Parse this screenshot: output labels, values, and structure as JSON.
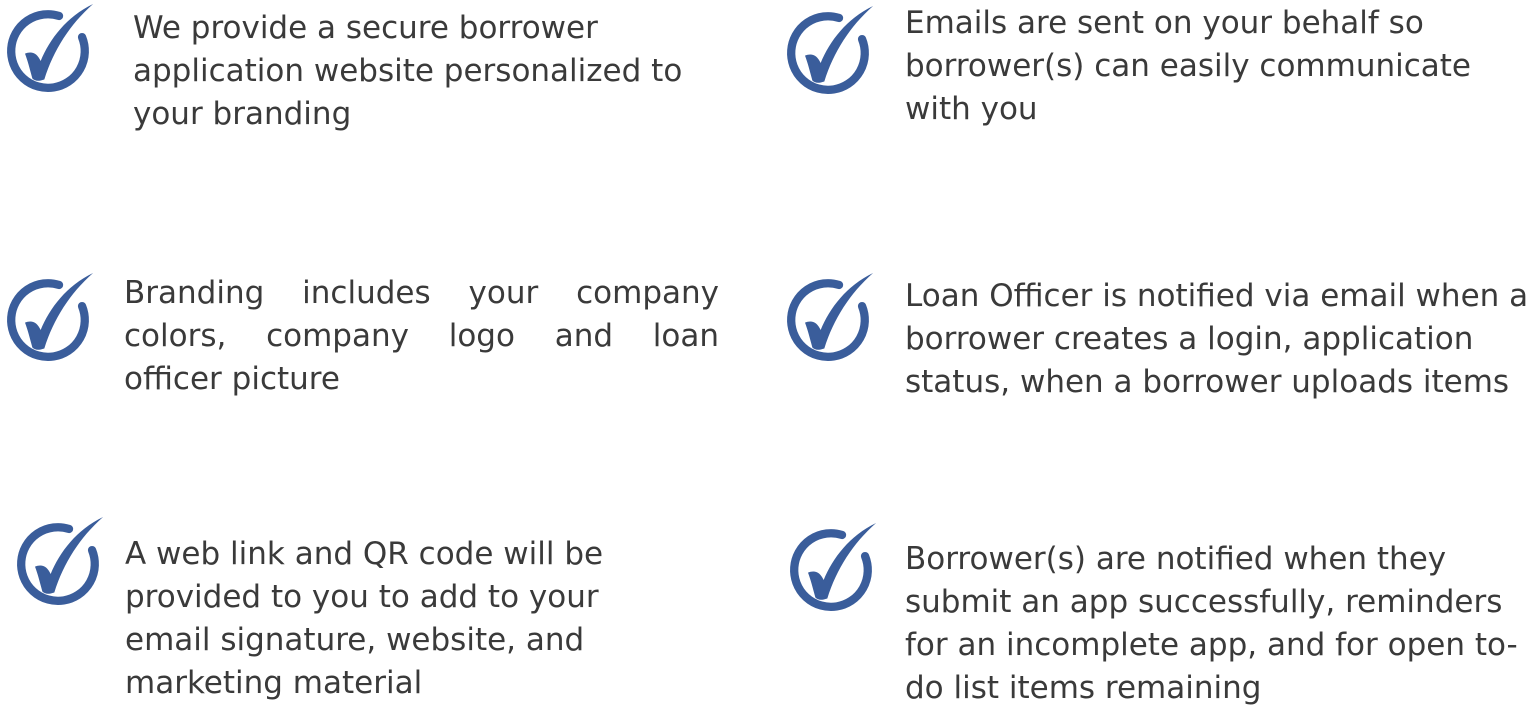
{
  "brand": {
    "check_color": "#3a5d9b",
    "text_color": "#3a3a3a"
  },
  "features": [
    {
      "icon": "checkmark-circle-icon",
      "lines": [
        "We provide a secure borrower",
        "application website personalized to",
        "your branding"
      ]
    },
    {
      "icon": "checkmark-circle-icon",
      "lines": [
        "Emails are sent on your behalf so",
        "borrower(s) can easily communicate",
        "with you"
      ]
    },
    {
      "icon": "checkmark-circle-icon",
      "lines": [
        "Branding includes your company",
        "colors, company logo and loan",
        "officer picture"
      ]
    },
    {
      "icon": "checkmark-circle-icon",
      "lines": [
        "Loan Officer is notified via email when a",
        "borrower creates a login, application",
        "status, when a borrower uploads items"
      ]
    },
    {
      "icon": "checkmark-circle-icon",
      "lines": [
        "A web link and QR code will be",
        "provided to you to add to your",
        "email  signature, website, and",
        "marketing material"
      ]
    },
    {
      "icon": "checkmark-circle-icon",
      "lines": [
        "Borrower(s) are notified when they",
        "submit an app successfully, reminders",
        "for an incomplete app, and for open to-",
        "do list items remaining"
      ]
    }
  ]
}
